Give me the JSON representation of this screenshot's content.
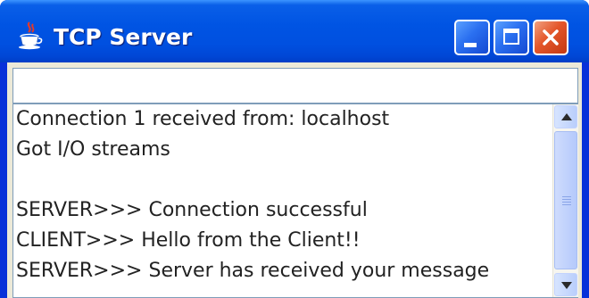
{
  "window": {
    "title": "TCP Server",
    "icon": "java-cup-icon",
    "controls": {
      "minimize": "minimize-icon",
      "maximize": "maximize-icon",
      "close": "close-icon"
    }
  },
  "input": {
    "value": "",
    "placeholder": ""
  },
  "output": {
    "lines": [
      "Connection 1 received from: localhost",
      "Got I/O streams",
      "",
      "SERVER>>> Connection successful",
      "CLIENT>>> Hello from the Client!!",
      "SERVER>>> Server has received your message"
    ]
  },
  "colors": {
    "titlebar": "#0054e3",
    "close_button": "#e4562a",
    "client_background": "#ece9d8",
    "field_border": "#7f9db9"
  }
}
